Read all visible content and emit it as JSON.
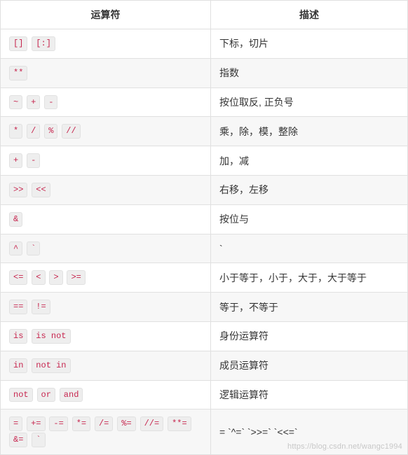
{
  "headers": {
    "operator": "运算符",
    "description": "描述"
  },
  "rows": [
    {
      "ops": [
        "[]",
        "[:]"
      ],
      "desc": "下标，切片"
    },
    {
      "ops": [
        "**"
      ],
      "desc": "指数"
    },
    {
      "ops": [
        "~",
        "+",
        "-"
      ],
      "desc": "按位取反, 正负号"
    },
    {
      "ops": [
        "*",
        "/",
        "%",
        "//"
      ],
      "desc": "乘，除，模，整除"
    },
    {
      "ops": [
        "+",
        "-"
      ],
      "desc": "加，减"
    },
    {
      "ops": [
        ">>",
        "<<"
      ],
      "desc": "右移，左移"
    },
    {
      "ops": [
        "&"
      ],
      "desc": "按位与"
    },
    {
      "ops": [
        "^",
        "`"
      ],
      "desc": "`"
    },
    {
      "ops": [
        "<=",
        "<",
        ">",
        ">="
      ],
      "desc": "小于等于，小于，大于，大于等于"
    },
    {
      "ops": [
        "==",
        "!="
      ],
      "desc": "等于，不等于"
    },
    {
      "ops": [
        "is",
        "is not"
      ],
      "desc": "身份运算符"
    },
    {
      "ops": [
        "in",
        "not in"
      ],
      "desc": "成员运算符"
    },
    {
      "ops": [
        "not",
        "or",
        "and"
      ],
      "desc": "逻辑运算符"
    },
    {
      "ops": [
        "=",
        "+=",
        "-=",
        "*=",
        "/=",
        "%=",
        "//=",
        "**=",
        "&=",
        "`"
      ],
      "desc": "= `^=` `>>=` `<<=`"
    }
  ],
  "watermark": "https://blog.csdn.net/wangc1994"
}
